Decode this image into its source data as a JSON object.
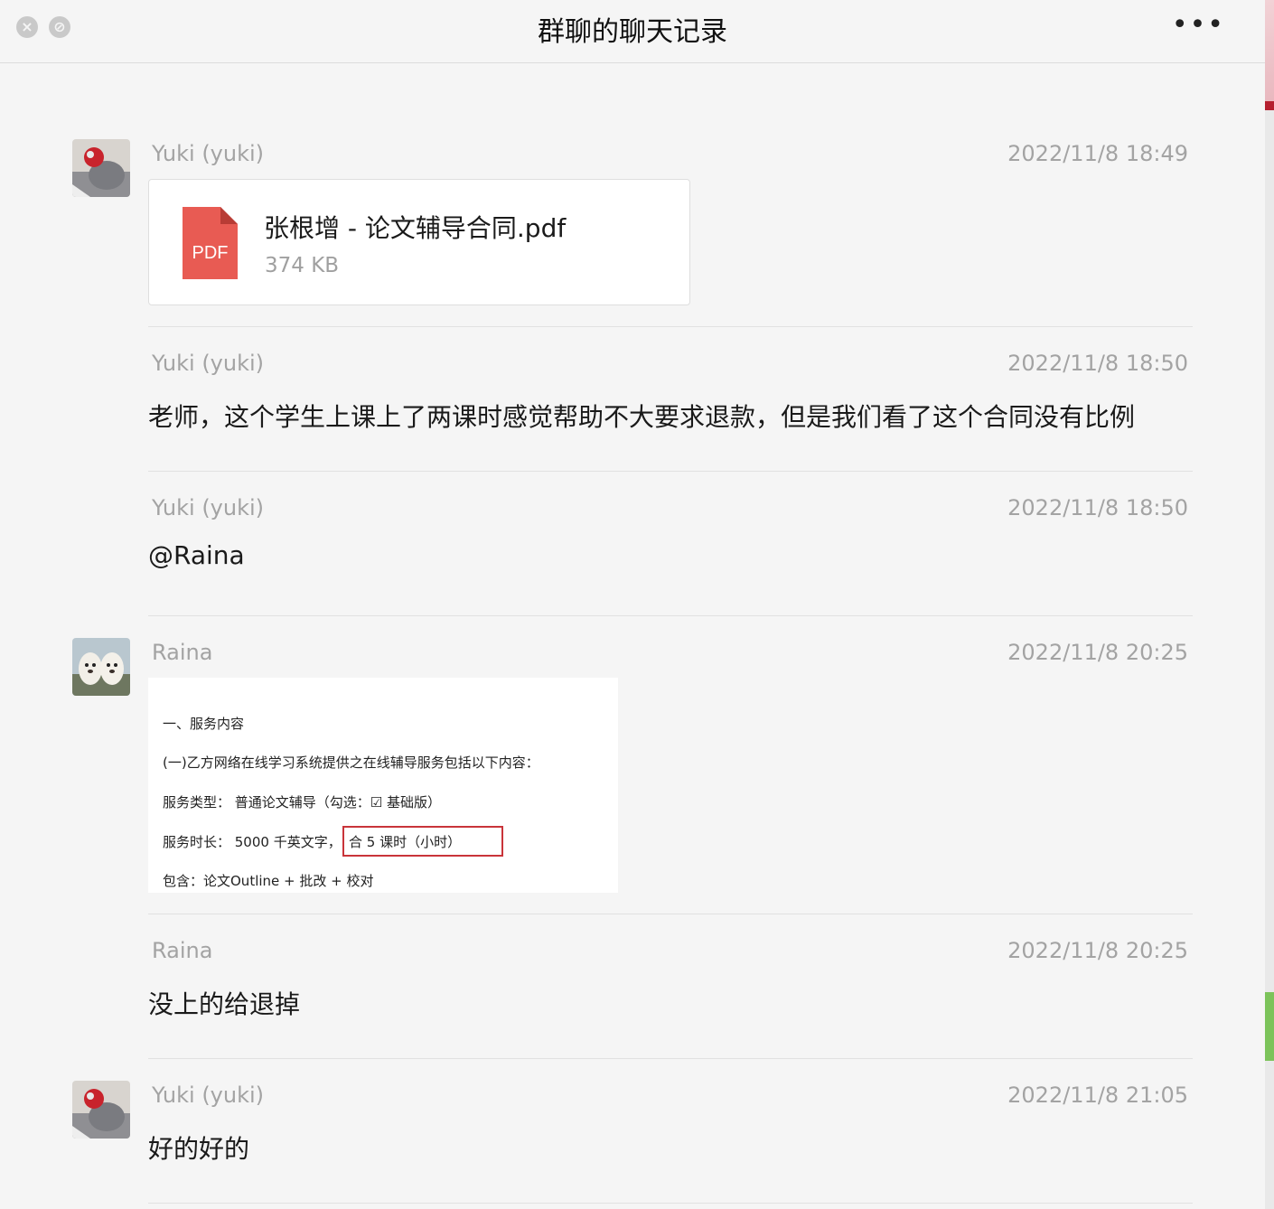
{
  "window": {
    "title": "群聊的聊天记录",
    "more_label": "•••"
  },
  "messages": [
    {
      "sender": "Yuki (yuki)",
      "time": "2022/11/8 18:49",
      "file": {
        "name": "张根增 - 论文辅导合同.pdf",
        "size": "374 KB",
        "icon_label": "PDF",
        "icon_color": "#e85b53"
      }
    },
    {
      "sender": "Yuki (yuki)",
      "time": "2022/11/8 18:50",
      "text": "老师，这个学生上课上了两课时感觉帮助不大要求退款，但是我们看了这个合同没有比例"
    },
    {
      "sender": "Yuki (yuki)",
      "time": "2022/11/8 18:50",
      "text": "@Raina"
    },
    {
      "sender": "Raina",
      "time": "2022/11/8 20:25",
      "image": {
        "lines": [
          "一、服务内容",
          "(一)乙方网络在线学习系统提供之在线辅导服务包括以下内容：",
          "服务类型：  普通论文辅导（勾选：☑  基础版）",
          "服务时长：  5000  千英文字，",
          "合  5  课时（小时）",
          "包含：论文Outline  +  批改  +  校对"
        ]
      }
    },
    {
      "sender": "Raina",
      "time": "2022/11/8 20:25",
      "text": "没上的给退掉"
    },
    {
      "sender": "Yuki (yuki)",
      "time": "2022/11/8 21:05",
      "text": "好的好的"
    }
  ]
}
